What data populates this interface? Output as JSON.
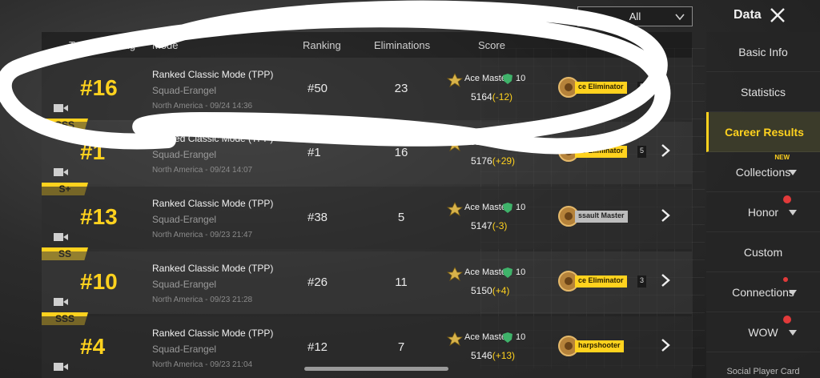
{
  "header": {
    "filter_value": "All",
    "title": "Data"
  },
  "table": {
    "columns": [
      "Team Ranking",
      "Mode",
      "Ranking",
      "Eliminations",
      "Score"
    ],
    "rows": [
      {
        "team_rank": "#16",
        "grade": "SSS",
        "mode": "Ranked Classic Mode (TPP)",
        "map": "Squad-Erangel",
        "meta": "North America - 09/24 14:36",
        "ranking": "#50",
        "eliminations": "23",
        "tier": "Ace Master",
        "tier_num": "10",
        "score": "5164",
        "delta": "(-12)",
        "badge": "ce Eliminator",
        "badge_count": "5"
      },
      {
        "team_rank": "#1",
        "grade": "S+",
        "mode": "Ranked Classic Mode (TPP)",
        "map": "Squad-Erangel",
        "meta": "North America - 09/24 14:07",
        "ranking": "#1",
        "eliminations": "16",
        "tier": "Ace Master",
        "tier_num": "10",
        "score": "5176",
        "delta": "(+29)",
        "badge": "ce Eliminator",
        "badge_count": "5"
      },
      {
        "team_rank": "#13",
        "grade": "SS",
        "mode": "Ranked Classic Mode (TPP)",
        "map": "Squad-Erangel",
        "meta": "North America - 09/23 21:47",
        "ranking": "#38",
        "eliminations": "5",
        "tier": "Ace Master",
        "tier_num": "10",
        "score": "5147",
        "delta": "(-3)",
        "badge": "ssault Master",
        "badge_count": ""
      },
      {
        "team_rank": "#10",
        "grade": "SSS",
        "mode": "Ranked Classic Mode (TPP)",
        "map": "Squad-Erangel",
        "meta": "North America - 09/23 21:28",
        "ranking": "#26",
        "eliminations": "11",
        "tier": "Ace Master",
        "tier_num": "10",
        "score": "5150",
        "delta": "(+4)",
        "badge": "ce Eliminator",
        "badge_count": "3"
      },
      {
        "team_rank": "#4",
        "grade": "",
        "mode": "Ranked Classic Mode (TPP)",
        "map": "Squad-Erangel",
        "meta": "North America - 09/23 21:04",
        "ranking": "#12",
        "eliminations": "7",
        "tier": "Ace Master",
        "tier_num": "10",
        "score": "5146",
        "delta": "(+13)",
        "badge": "harpshooter",
        "badge_count": ""
      }
    ]
  },
  "sidebar": {
    "items": [
      {
        "label": "Basic Info"
      },
      {
        "label": "Statistics"
      },
      {
        "label": "Career Results",
        "active": true
      },
      {
        "label": "Collections",
        "tag": "NEW"
      },
      {
        "label": "Honor"
      },
      {
        "label": "Custom"
      },
      {
        "label": "Connections"
      },
      {
        "label": "WOW"
      },
      {
        "label": "Social Player Card"
      }
    ]
  },
  "colors": {
    "accent": "#ffd21e",
    "panel": "#262626",
    "text": "#e6e6e6"
  }
}
